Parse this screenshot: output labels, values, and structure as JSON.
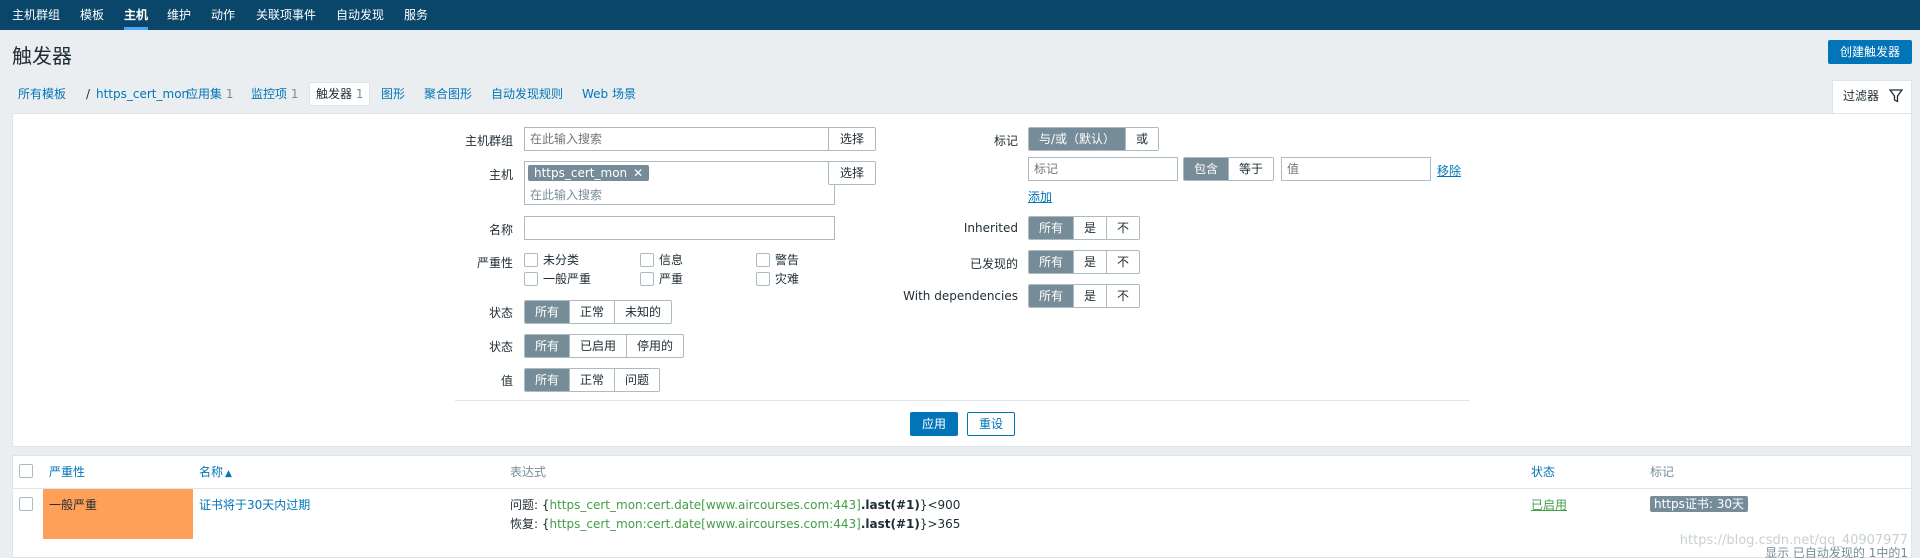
{
  "topnav": {
    "items": [
      "主机群组",
      "模板",
      "主机",
      "维护",
      "动作",
      "关联项事件",
      "自动发现",
      "服务"
    ],
    "active_index": 2
  },
  "header": {
    "title": "触发器",
    "create_button": "创建触发器"
  },
  "breadcrumb": {
    "all_templates": "所有模板",
    "separator": "/",
    "template": "https_cert_mon",
    "tabs": [
      {
        "label": "应用集",
        "count": "1"
      },
      {
        "label": "监控项",
        "count": "1"
      },
      {
        "label": "触发器",
        "count": "1",
        "active": true
      },
      {
        "label": "图形",
        "count": ""
      },
      {
        "label": "聚合图形",
        "count": ""
      },
      {
        "label": "自动发现规则",
        "count": ""
      },
      {
        "label": "Web 场景",
        "count": ""
      }
    ]
  },
  "filter": {
    "tab_label": "过滤器",
    "host_group": {
      "label": "主机群组",
      "placeholder": "在此输入搜索",
      "select_button": "选择"
    },
    "host": {
      "label": "主机",
      "chip": "https_cert_mon",
      "placeholder": "在此输入搜索",
      "select_button": "选择"
    },
    "name": {
      "label": "名称",
      "value": ""
    },
    "severity": {
      "label": "严重性",
      "options": [
        "未分类",
        "信息",
        "警告",
        "一般严重",
        "严重",
        "灾难"
      ]
    },
    "state": {
      "label": "状态",
      "options": [
        "所有",
        "正常",
        "未知的"
      ],
      "selected": 0
    },
    "status": {
      "label": "状态",
      "options": [
        "所有",
        "已启用",
        "停用的"
      ],
      "selected": 0
    },
    "value": {
      "label": "值",
      "options": [
        "所有",
        "正常",
        "问题"
      ],
      "selected": 0
    },
    "tags": {
      "label": "标记",
      "mode_options": [
        "与/或（默认）",
        "或"
      ],
      "mode_selected": 0,
      "tag_placeholder": "标记",
      "operator_options": [
        "包含",
        "等于"
      ],
      "operator_selected": 0,
      "value_placeholder": "值",
      "remove_link": "移除",
      "add_link": "添加"
    },
    "inherited": {
      "label": "Inherited",
      "options": [
        "所有",
        "是",
        "不"
      ],
      "selected": 0
    },
    "discovered": {
      "label": "已发现的",
      "options": [
        "所有",
        "是",
        "不"
      ],
      "selected": 0
    },
    "with_dependencies": {
      "label": "With dependencies",
      "options": [
        "所有",
        "是",
        "不"
      ],
      "selected": 0
    },
    "apply_button": "应用",
    "reset_button": "重设"
  },
  "table": {
    "headers": {
      "severity": "严重性",
      "name": "名称",
      "sort_indicator": "▲",
      "expression": "表达式",
      "status": "状态",
      "tags": "标记"
    },
    "rows": [
      {
        "severity": "一般严重",
        "severity_color": "#ffa059",
        "name": "证书将于30天内过期",
        "problem_prefix": "问题: {",
        "problem_item": "https_cert_mon:cert.date[www.aircourses.com:443]",
        "problem_func": ".last(#1)",
        "problem_suffix": "}<900",
        "recovery_prefix": "恢复: {",
        "recovery_item": "https_cert_mon:cert.date[www.aircourses.com:443]",
        "recovery_func": ".last(#1)",
        "recovery_suffix": "}>365",
        "status": "已启用",
        "tag": "https证书: 30天"
      }
    ]
  },
  "footer": {
    "summary": "显示 已自动发现的 1中的1"
  },
  "watermark": "https://blog.csdn.net/qq_40907977"
}
